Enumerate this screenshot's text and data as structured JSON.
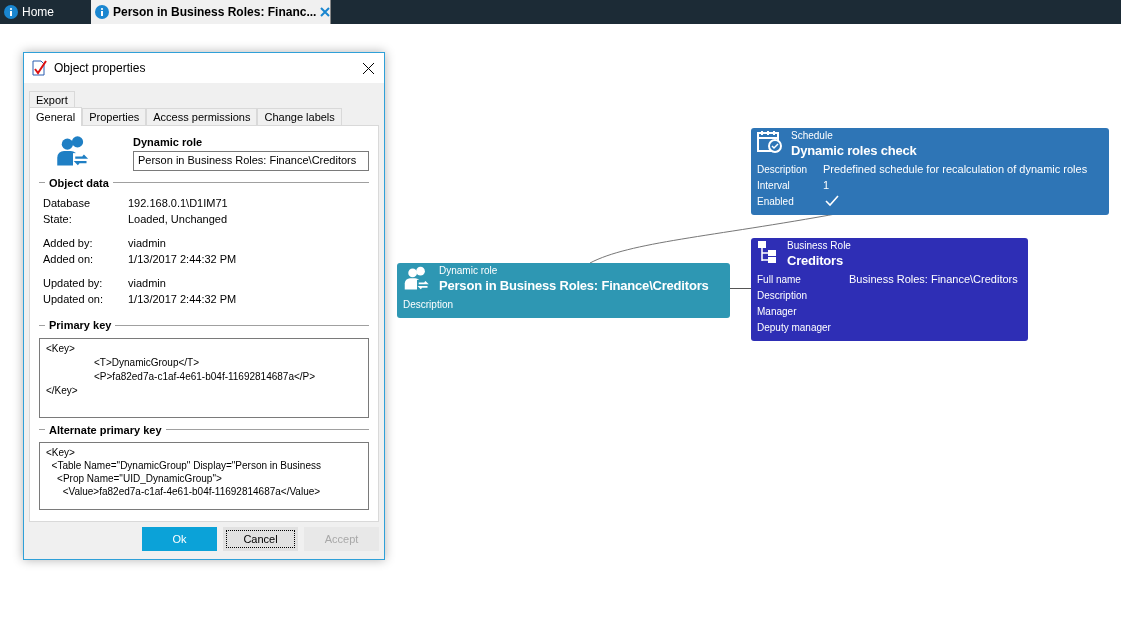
{
  "top_tabs": [
    {
      "label": "Home",
      "selected": false,
      "closable": false
    },
    {
      "label": "Person in Business Roles: Financ...",
      "selected": true,
      "closable": true
    }
  ],
  "dialog": {
    "title": "Object properties",
    "tab_rows": [
      [
        {
          "label": "Export",
          "selected": false
        }
      ],
      [
        {
          "label": "General",
          "selected": true
        },
        {
          "label": "Properties",
          "selected": false
        },
        {
          "label": "Access permissions",
          "selected": false
        },
        {
          "label": "Change labels",
          "selected": false
        }
      ]
    ],
    "header": {
      "label": "Dynamic role",
      "value": "Person in Business Roles: Finance\\Creditors"
    },
    "object_data": {
      "title": "Object data",
      "groups": [
        [
          {
            "label": "Database",
            "value": "192.168.0.1\\D1IM71"
          },
          {
            "label": "State:",
            "value": "Loaded, Unchanged"
          }
        ],
        [
          {
            "label": "Added by:",
            "value": "viadmin"
          },
          {
            "label": "Added on:",
            "value": "1/13/2017 2:44:32 PM"
          }
        ],
        [
          {
            "label": "Updated by:",
            "value": "viadmin"
          },
          {
            "label": "Updated on:",
            "value": "1/13/2017 2:44:32 PM"
          }
        ]
      ]
    },
    "primary_key": {
      "title": "Primary key",
      "lines": [
        {
          "text": "<Key>",
          "indent": false
        },
        {
          "text": "<T>DynamicGroup</T>",
          "indent": true
        },
        {
          "text": "<P>fa82ed7a-c1af-4e61-b04f-11692814687a</P>",
          "indent": true
        },
        {
          "text": "</Key>",
          "indent": false
        }
      ]
    },
    "alternate_key": {
      "title": "Alternate primary key",
      "lines": [
        "<Key>",
        "  <Table Name=\"DynamicGroup\" Display=\"Person in Business",
        "    <Prop Name=\"UID_DynamicGroup\">",
        "      <Value>fa82ed7a-c1af-4e61-b04f-11692814687a</Value>"
      ]
    },
    "buttons": [
      {
        "label": "Ok",
        "kind": "primary",
        "disabled": false
      },
      {
        "label": "Cancel",
        "kind": "focused",
        "disabled": false
      },
      {
        "label": "Accept",
        "kind": "normal",
        "disabled": true
      }
    ]
  },
  "nodes": [
    {
      "kind": "schedule",
      "type": "Schedule",
      "title": "Dynamic roles check",
      "color": "#2e75b6",
      "fields": [
        {
          "label": "Description",
          "value": "Predefined schedule for recalculation of dynamic roles"
        },
        {
          "label": "Interval",
          "value": "1"
        },
        {
          "label": "Enabled",
          "checked": true
        }
      ]
    },
    {
      "kind": "dynamic_role",
      "type": "Dynamic role",
      "title": "Person in Business Roles: Finance\\Creditors",
      "color": "#2e97b3",
      "fields": [
        {
          "label": "Description"
        }
      ]
    },
    {
      "kind": "business_role",
      "type": "Business Role",
      "title": "Creditors",
      "color": "#2e2eb5",
      "fields": [
        {
          "label": "Full name",
          "value": "Business Roles: Finance\\Creditors"
        },
        {
          "label": "Description"
        },
        {
          "label": "Manager"
        },
        {
          "label": "Deputy manager"
        }
      ]
    }
  ]
}
